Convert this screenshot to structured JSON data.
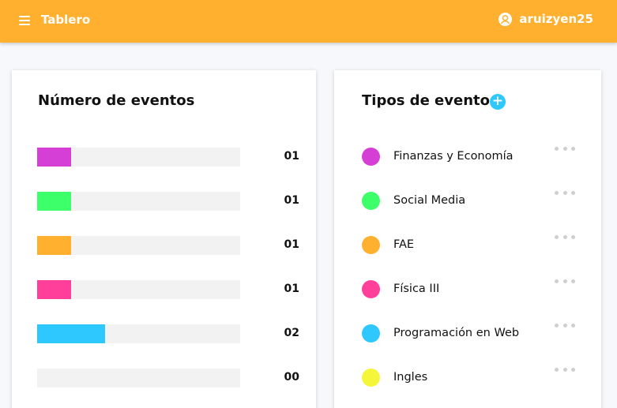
{
  "header": {
    "title": "Tablero",
    "username": "aruizyen25",
    "bg_color": "#ffb02e"
  },
  "events_card": {
    "title": "Número de eventos",
    "bars": [
      {
        "value_label": "01",
        "value": 1,
        "color": "#d63fd6"
      },
      {
        "value_label": "01",
        "value": 1,
        "color": "#3dff6a"
      },
      {
        "value_label": "01",
        "value": 1,
        "color": "#ffb02e"
      },
      {
        "value_label": "01",
        "value": 1,
        "color": "#ff3f9a"
      },
      {
        "value_label": "02",
        "value": 2,
        "color": "#2ec8ff"
      },
      {
        "value_label": "00",
        "value": 0,
        "color": "#f5f53a"
      }
    ],
    "max_value": 6
  },
  "types_card": {
    "title": "Tipos de evento",
    "add_icon": "plus-icon",
    "items": [
      {
        "label": "Finanzas y Economía",
        "color": "#d63fd6"
      },
      {
        "label": "Social Media",
        "color": "#3dff6a"
      },
      {
        "label": "FAE",
        "color": "#ffb02e"
      },
      {
        "label": "Física III",
        "color": "#ff3f9a"
      },
      {
        "label": "Programación en Web",
        "color": "#2ec8ff"
      },
      {
        "label": "Ingles",
        "color": "#f5f53a"
      }
    ],
    "more_icon": "more-horizontal-icon"
  }
}
